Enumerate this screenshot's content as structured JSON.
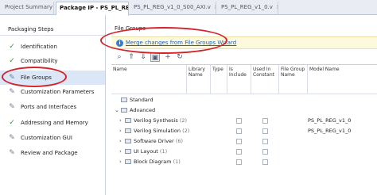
{
  "tabs": [
    {
      "label": "Project Summary",
      "close": "×"
    },
    {
      "label": "Package IP - PS_PL_REG",
      "close": "×"
    },
    {
      "label": "PS_PL_REG_v1_0_S00_AXI.v",
      "close": "×"
    },
    {
      "label": "PS_PL_REG_v1_0.v",
      "close": "×"
    }
  ],
  "left": {
    "heading": "Packaging Steps",
    "steps": [
      {
        "label": "Identification",
        "icon": "check"
      },
      {
        "label": "Compatibility",
        "icon": "check"
      },
      {
        "label": "File Groups",
        "icon": "pencil"
      },
      {
        "label": "Customization Parameters",
        "icon": "pencil"
      },
      {
        "label": "Ports and Interfaces",
        "icon": "pencil"
      },
      {
        "label": "Addressing and Memory",
        "icon": "check"
      },
      {
        "label": "Customization GUI",
        "icon": "pencil"
      },
      {
        "label": "Review and Package",
        "icon": "pencil"
      }
    ]
  },
  "right": {
    "heading": "File Groups",
    "banner_link": "Merge changes from File Groups Wizard",
    "toolbar": [
      "search-icon",
      "collapse-all-icon",
      "expand-all-icon",
      "edit-icon",
      "add-icon",
      "refresh-icon"
    ],
    "columns": {
      "name": "Name",
      "library": "Library Name",
      "type": "Type",
      "include": "Is Include",
      "constant": "Used In Constant",
      "fgname": "File Group Name",
      "model": "Model Name"
    },
    "rows": [
      {
        "name": "Standard",
        "count": "",
        "indent": 1,
        "arrow": "",
        "checks": false,
        "model": ""
      },
      {
        "name": "Advanced",
        "count": "",
        "indent": 0,
        "arrow": "⌄",
        "checks": false,
        "model": ""
      },
      {
        "name": "Verilog Synthesis",
        "count": "(2)",
        "indent": 1,
        "arrow": "›",
        "checks": true,
        "model": "PS_PL_REG_v1_0"
      },
      {
        "name": "Verilog Simulation",
        "count": "(2)",
        "indent": 1,
        "arrow": "›",
        "checks": true,
        "model": "PS_PL_REG_v1_0"
      },
      {
        "name": "Software Driver",
        "count": "(6)",
        "indent": 1,
        "arrow": "›",
        "checks": true,
        "model": ""
      },
      {
        "name": "UI Layout",
        "count": "(1)",
        "indent": 1,
        "arrow": "›",
        "checks": true,
        "model": ""
      },
      {
        "name": "Block Diagram",
        "count": "(1)",
        "indent": 1,
        "arrow": "›",
        "checks": true,
        "model": ""
      }
    ]
  },
  "colors": {
    "accent": "#1f5fbf",
    "annotation": "#d2232a",
    "selected": "#dbe6f7",
    "check": "#2a9a3a"
  }
}
